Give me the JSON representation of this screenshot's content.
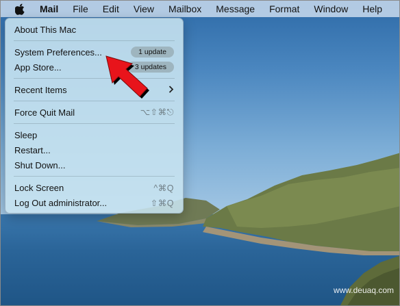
{
  "menubar": {
    "apple_icon": "apple-logo-icon",
    "items": [
      {
        "label": "Mail",
        "bold": true
      },
      {
        "label": "File"
      },
      {
        "label": "Edit"
      },
      {
        "label": "View"
      },
      {
        "label": "Mailbox"
      },
      {
        "label": "Message"
      },
      {
        "label": "Format"
      },
      {
        "label": "Window"
      },
      {
        "label": "Help"
      }
    ]
  },
  "apple_menu": {
    "about": "About This Mac",
    "system_preferences": {
      "label": "System Preferences...",
      "badge": "1 update"
    },
    "app_store": {
      "label": "App Store...",
      "badge": "3 updates"
    },
    "recent_items": {
      "label": "Recent Items",
      "submenu_icon": "chevron-right-icon"
    },
    "force_quit": {
      "label": "Force Quit Mail",
      "shortcut": "⌥⇧⌘⎋"
    },
    "sleep": "Sleep",
    "restart": "Restart...",
    "shut_down": "Shut Down...",
    "lock_screen": {
      "label": "Lock Screen",
      "shortcut": "^⌘Q"
    },
    "log_out": {
      "label": "Log Out administrator...",
      "shortcut": "⇧⌘Q"
    }
  },
  "annotation": {
    "arrow_color": "#e8141b"
  },
  "watermark": "www.deuaq.com"
}
